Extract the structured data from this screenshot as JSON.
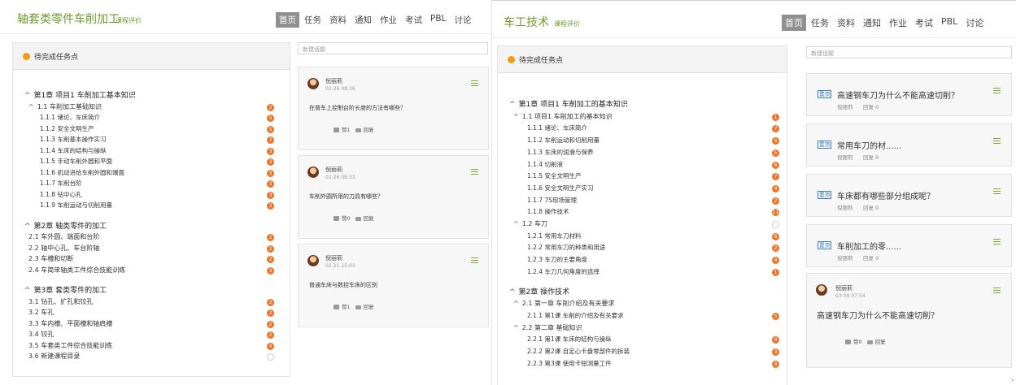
{
  "panel_a": {
    "title": "轴套类零件车削加工",
    "subtitle": "课程评价",
    "nav": [
      "首页",
      "任务",
      "资料",
      "通知",
      "作业",
      "考试",
      "PBL",
      "讨论"
    ],
    "nav_active": 0,
    "task_header": "待完成任务点",
    "search_placeholder": "新建话题",
    "outline": [
      {
        "text": "第1章 项目1 车削加工基本知识",
        "level": 0,
        "caret": "^",
        "badge": ""
      },
      {
        "text": "1.1  车削加工基础知识",
        "level": 1,
        "caret": "^",
        "badge": "2"
      },
      {
        "text": "1.1.1 绪论、车床简介",
        "level": 2,
        "caret": "",
        "badge": "5"
      },
      {
        "text": "1.1.2 安全文明生产",
        "level": 2,
        "caret": "",
        "badge": "5"
      },
      {
        "text": "1.1.3 车削基本操作实习",
        "level": 2,
        "caret": "",
        "badge": "7"
      },
      {
        "text": "1.1.4 车床的结构与操纵",
        "level": 2,
        "caret": "",
        "badge": "3"
      },
      {
        "text": "1.1.5 手动车削外圆和平面",
        "level": 2,
        "caret": "",
        "badge": "3"
      },
      {
        "text": "1.1.6 机动进给车削外圆和端面",
        "level": 2,
        "caret": "",
        "badge": "3"
      },
      {
        "text": "1.1.7 车削台阶",
        "level": 2,
        "caret": "",
        "badge": "3"
      },
      {
        "text": "1.1.8 钻中心孔",
        "level": 2,
        "caret": "",
        "badge": "3"
      },
      {
        "text": "1.1.9 车削运动与切削用量",
        "level": 2,
        "caret": "",
        "badge": "3"
      },
      {
        "text": "第2章 轴类零件的加工",
        "level": 0,
        "caret": "^",
        "badge": ""
      },
      {
        "text": "2.1  车外圆、端面和台阶",
        "level": 1,
        "caret": "",
        "badge": "2"
      },
      {
        "text": "2.2  轴中心孔、车台阶轴",
        "level": 1,
        "caret": "",
        "badge": "2"
      },
      {
        "text": "2.3  车槽和切断",
        "level": 1,
        "caret": "",
        "badge": "2"
      },
      {
        "text": "2.4  车简单轴类工件综合技能训练",
        "level": 1,
        "caret": "",
        "badge": "3"
      },
      {
        "text": "第3章 套类零件的加工",
        "level": 0,
        "caret": "^",
        "badge": ""
      },
      {
        "text": "3.1  钻孔、扩孔和铰孔",
        "level": 1,
        "caret": "",
        "badge": "2"
      },
      {
        "text": "3.2  车孔",
        "level": 1,
        "caret": "",
        "badge": "2"
      },
      {
        "text": "3.3  车内槽、平面槽和轴肩槽",
        "level": 1,
        "caret": "",
        "badge": "2"
      },
      {
        "text": "3.4  铰孔",
        "level": 1,
        "caret": "",
        "badge": "2"
      },
      {
        "text": "3.5  车套类工件综合技能训练",
        "level": 1,
        "caret": "",
        "badge": "4"
      },
      {
        "text": "3.6  新建课程目录",
        "level": 1,
        "caret": "",
        "badge": ""
      }
    ],
    "posts": [
      {
        "author": "倪丽莉",
        "date": "02-26 08:36",
        "text": "在普车上控制台阶长度的方法有哪些？",
        "likes": "赞1",
        "reply": "回复"
      },
      {
        "author": "倪丽莉",
        "date": "02-26 08:33",
        "text": "车削外圆所用的刀具有哪些？",
        "likes": "赞0",
        "reply": "回复"
      },
      {
        "author": "倪丽莉",
        "date": "02-25 15:03",
        "text": "普通车床与数控车床的区别",
        "likes": "赞1",
        "reply": "回复"
      }
    ]
  },
  "panel_b": {
    "title": "车工技术",
    "subtitle": "课程评价",
    "nav": [
      "首页",
      "任务",
      "资料",
      "通知",
      "作业",
      "考试",
      "PBL",
      "讨论"
    ],
    "nav_active": 0,
    "task_header": "待完成任务点",
    "search_placeholder": "新建话题",
    "outline": [
      {
        "text": "第1章 项目1 车削加工的基本知识",
        "level": 0,
        "caret": "^",
        "badge": ""
      },
      {
        "text": "1.1  项目1 车削加工的基本知识",
        "level": 1,
        "caret": "^",
        "badge": "1"
      },
      {
        "text": "1.1.1 绪论、车床简介",
        "level": 2,
        "caret": "",
        "badge": "7"
      },
      {
        "text": "1.1.2 车削运动和切削用量",
        "level": 2,
        "caret": "",
        "badge": "4"
      },
      {
        "text": "1.1.3 车床的润滑与保养",
        "level": 2,
        "caret": "",
        "badge": "5"
      },
      {
        "text": "1.1.4 切削液",
        "level": 2,
        "caret": "",
        "badge": "6"
      },
      {
        "text": "1.1.5 安全文明生产",
        "level": 2,
        "caret": "",
        "badge": "7"
      },
      {
        "text": "1.1.6 安全文明生产实习",
        "level": 2,
        "caret": "",
        "badge": "4"
      },
      {
        "text": "1.1.7 7S现场管理",
        "level": 2,
        "caret": "",
        "badge": "2"
      },
      {
        "text": "1.1.8 操作技术",
        "level": 2,
        "caret": "",
        "badge": "11"
      },
      {
        "text": "1.2  车刀",
        "level": 1,
        "caret": "^",
        "badge": ""
      },
      {
        "text": "1.2.1 常用车刀材料",
        "level": 2,
        "caret": "",
        "badge": "6"
      },
      {
        "text": "1.2.2 常用车刀的种类和用途",
        "level": 2,
        "caret": "",
        "badge": "2"
      },
      {
        "text": "1.2.3 车刀的主要角度",
        "level": 2,
        "caret": "",
        "badge": "4"
      },
      {
        "text": "1.2.4 车刀几何角度的选择",
        "level": 2,
        "caret": "",
        "badge": "1"
      },
      {
        "text": "第2章 操作技术",
        "level": 0,
        "caret": "^",
        "badge": ""
      },
      {
        "text": "2.1  第一章 车削介绍及有关要求",
        "level": 1,
        "caret": "^",
        "badge": ""
      },
      {
        "text": "2.1.1 第1课 车削的介绍及有关要求",
        "level": 2,
        "caret": "",
        "badge": "5"
      },
      {
        "text": "2.2  第二章 基础知识",
        "level": 1,
        "caret": "^",
        "badge": ""
      },
      {
        "text": "2.2.1 第1课 车床的结构与操纵",
        "level": 2,
        "caret": "",
        "badge": "4"
      },
      {
        "text": "2.2.2 第2课 自定心卡盘零部件的拆装",
        "level": 2,
        "caret": "",
        "badge": "3"
      },
      {
        "text": "2.2.3 第3课 使用卡钳测量工件",
        "level": 2,
        "caret": "",
        "badge": "4"
      }
    ],
    "topics": [
      {
        "tag": "置顶",
        "title": "高速钢车刀为什么不能高速切削？",
        "author": "倪丽莉",
        "reply": "回复 0"
      },
      {
        "tag": "置顶",
        "title": "常用车刀的材......",
        "author": "倪丽莉",
        "reply": "回复 0"
      },
      {
        "tag": "置顶",
        "title": "车床都有哪些部分组成呢？",
        "author": "倪丽莉",
        "reply": "回复 0"
      },
      {
        "tag": "置顶",
        "title": "车削加工的零......",
        "author": "倪丽莉",
        "reply": "回复 0"
      }
    ],
    "post": {
      "author": "倪丽莉",
      "date": "03-09 07:54",
      "text": "高速钢车刀为什么不能高速切削？",
      "likes": "赞0",
      "reply": "回复"
    }
  }
}
